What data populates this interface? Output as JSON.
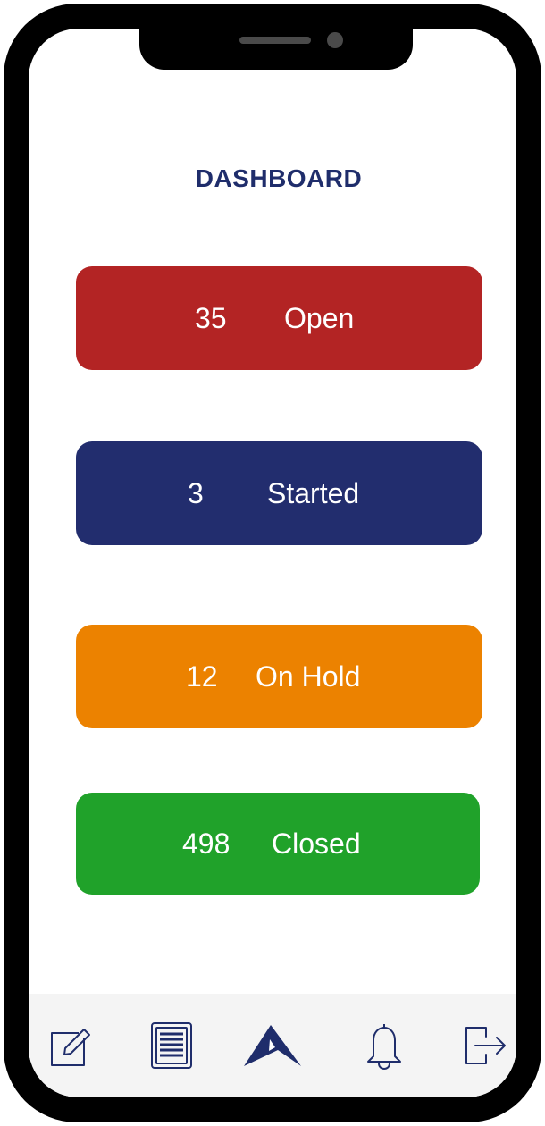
{
  "header": {
    "title": "DASHBOARD"
  },
  "tiles": [
    {
      "count": "35",
      "label": "Open",
      "color": "#b32424"
    },
    {
      "count": "3",
      "label": "Started",
      "color": "#222d6e"
    },
    {
      "count": "12",
      "label": "On Hold",
      "color": "#ec8200"
    },
    {
      "count": "498",
      "label": "Closed",
      "color": "#20a22a"
    }
  ],
  "tabbar": {
    "items": [
      {
        "icon": "edit-icon"
      },
      {
        "icon": "list-icon"
      },
      {
        "icon": "logo-icon"
      },
      {
        "icon": "bell-icon"
      },
      {
        "icon": "logout-icon"
      }
    ],
    "icon_color": "#1f2d6b"
  },
  "theme": {
    "accent": "#1f2d6b",
    "background": "#ffffff",
    "tabbar_background": "#f4f4f4"
  }
}
